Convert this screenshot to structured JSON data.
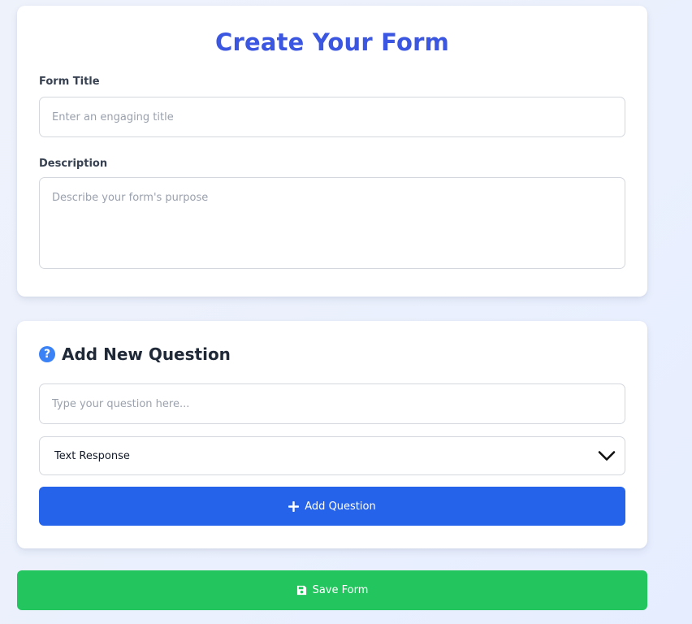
{
  "form_card": {
    "title": "Create Your Form",
    "form_title_label": "Form Title",
    "form_title_placeholder": "Enter an engaging title",
    "form_title_value": "",
    "description_label": "Description",
    "description_placeholder": "Describe your form's purpose",
    "description_value": ""
  },
  "question_card": {
    "heading": "Add New Question",
    "heading_icon": "question-circle-icon",
    "question_placeholder": "Type your question here...",
    "question_value": "",
    "type_select": {
      "selected": "Text Response",
      "icon": "chevron-down-icon"
    },
    "add_button_label": "Add Question",
    "add_button_icon": "plus-icon"
  },
  "save_button": {
    "label": "Save Form",
    "icon": "save-icon"
  },
  "colors": {
    "title": "#3b56e0",
    "primary": "#2563eb",
    "success": "#22c55e",
    "info_icon": "#3b82f6"
  }
}
